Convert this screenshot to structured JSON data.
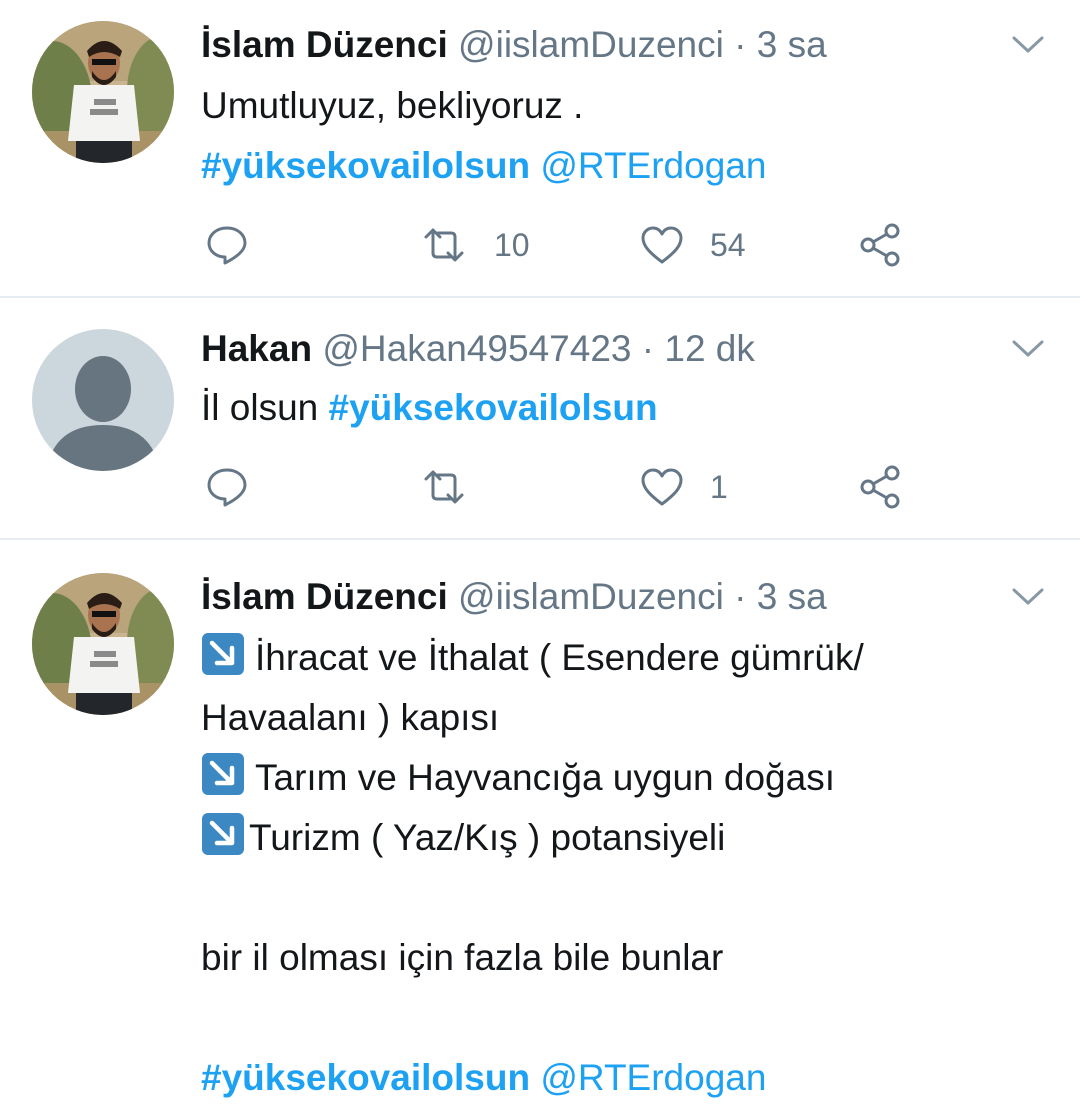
{
  "tweets": [
    {
      "name": "İslam Düzenci",
      "handle": "@iislamDuzenci",
      "separator": "·",
      "time": "3 sa",
      "lines": [
        {
          "text": "Umutluyuz, bekliyoruz ."
        }
      ],
      "hashtag": "#yüksekovailolsun",
      "mention": "@RTErdogan",
      "retweet_count": "10",
      "like_count": "54",
      "avatar_icon": "profile-photo"
    },
    {
      "name": "Hakan",
      "handle": "@Hakan49547423",
      "separator": "·",
      "time": "12 dk",
      "text_prefix": "İl olsun",
      "hashtag": "#yüksekovailolsun",
      "retweet_count": "",
      "like_count": "1",
      "avatar_icon": "default-avatar-icon"
    },
    {
      "name": "İslam Düzenci",
      "handle": "@iislamDuzenci",
      "separator": "·",
      "time": "3 sa",
      "lines": [
        {
          "text": "İhracat ve İthalat ( Esendere gümrük/"
        },
        {
          "text": "Havaalanı ) kapısı"
        },
        {
          "text": "Tarım ve Hayvancığa uygun doğası"
        },
        {
          "text": "Turizm ( Yaz/Kış ) potansiyeli"
        },
        {
          "text": "bir il olması için fazla bile bunlar"
        }
      ],
      "hashtag": "#yüksekovailolsun",
      "mention": "@RTErdogan",
      "avatar_icon": "profile-photo"
    }
  ],
  "icons": {
    "reply": "reply-icon",
    "retweet": "retweet-icon",
    "like": "heart-icon",
    "share": "share-icon",
    "caret": "chevron-down-icon",
    "bullet": "down-right-arrow-emoji"
  },
  "colors": {
    "link": "#1da1f2",
    "muted": "#657786",
    "text": "#14171a",
    "divider": "#e6ecf0"
  }
}
